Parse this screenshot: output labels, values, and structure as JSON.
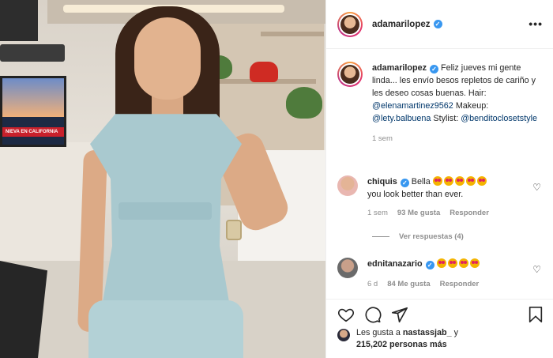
{
  "post": {
    "username": "adamarilopez",
    "more_label": "•••",
    "monitor_ticker": "NIEVA EN CALIFORNIA"
  },
  "caption": {
    "username": "adamarilopez",
    "text_1": "Feliz jueves mi gente linda... les envío besos repletos de cariño y les deseo cosas buenas. Hair:",
    "mention_1": "@elenamartinez9562",
    "text_2": "Makeup:",
    "mention_2": "@lety.balbuena",
    "text_3": "Stylist:",
    "mention_3": "@benditoclosetstyle",
    "time": "1 sem"
  },
  "comments": [
    {
      "username": "chiquis",
      "text": "Bella",
      "text_2": "you look better than ever.",
      "emoji_count": 5,
      "time": "1 sem",
      "likes": "93 Me gusta",
      "reply_label": "Responder",
      "avatar_color": "#e9b7b1"
    },
    {
      "username": "ednitanazario",
      "text": "",
      "emoji_count": 4,
      "time": "6 d",
      "likes": "84 Me gusta",
      "reply_label": "Responder",
      "avatar_color": "#8a8a8a"
    }
  ],
  "replies": {
    "label": "Ver respuestas (4)"
  },
  "likes": {
    "prefix": "Les gusta a",
    "user": "nastassjab_",
    "conj": "y",
    "count": "215,202 personas más"
  },
  "icons": {
    "like": "heart-icon",
    "comment": "comment-icon",
    "share": "send-icon",
    "save": "bookmark-icon"
  },
  "colors": {
    "verified": "#3897f0",
    "mention": "#00376b",
    "muted": "#8e8e8e"
  }
}
